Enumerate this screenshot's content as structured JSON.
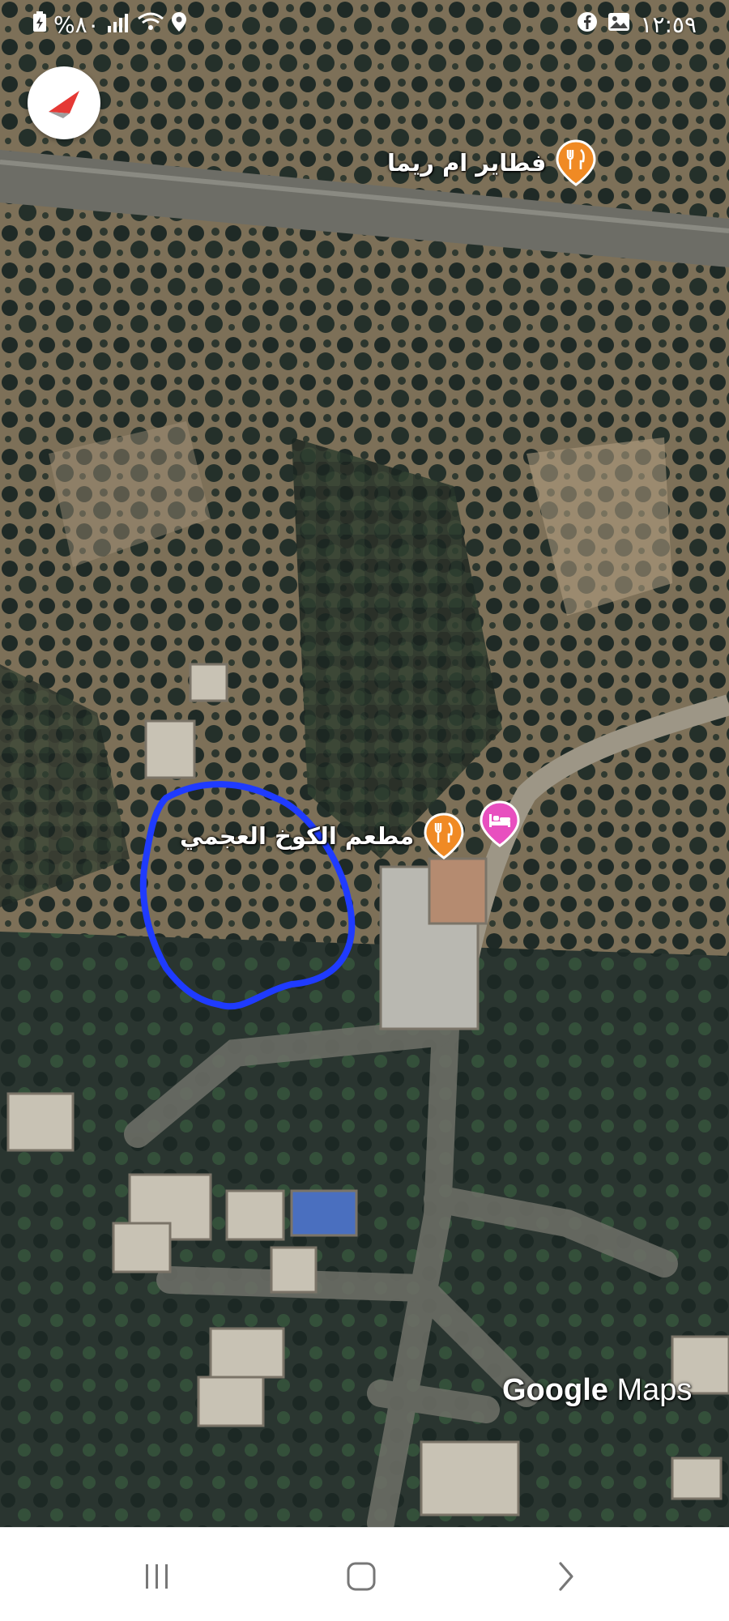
{
  "status_bar": {
    "battery_text": "%٨٠",
    "time": "١٢:٥٩",
    "left_icons": [
      "battery-saver-icon",
      "signal-icon",
      "wifi-icon",
      "location-icon"
    ],
    "right_icons": [
      "facebook-icon",
      "gallery-icon"
    ]
  },
  "map": {
    "type": "satellite",
    "places": [
      {
        "name": "فطاير ام ريما",
        "category": "restaurant",
        "icon": "fork-knife-icon",
        "color": "#F08A24"
      },
      {
        "name": "مطعم الكوخ العجمي",
        "category": "restaurant",
        "icon": "fork-knife-icon",
        "color": "#F08A24"
      },
      {
        "name": "",
        "category": "hotel",
        "icon": "bed-icon",
        "color": "#E84FBF"
      }
    ],
    "drawn_outline_color": "#1F3BFF",
    "attribution": {
      "brand": "Google",
      "product": "Maps"
    },
    "compass_icon": "compass-icon"
  },
  "nav_bar": {
    "buttons": [
      {
        "name": "recent-apps-button",
        "icon": "recent-apps-icon"
      },
      {
        "name": "home-button",
        "icon": "home-icon"
      },
      {
        "name": "back-button",
        "icon": "back-icon"
      }
    ]
  }
}
